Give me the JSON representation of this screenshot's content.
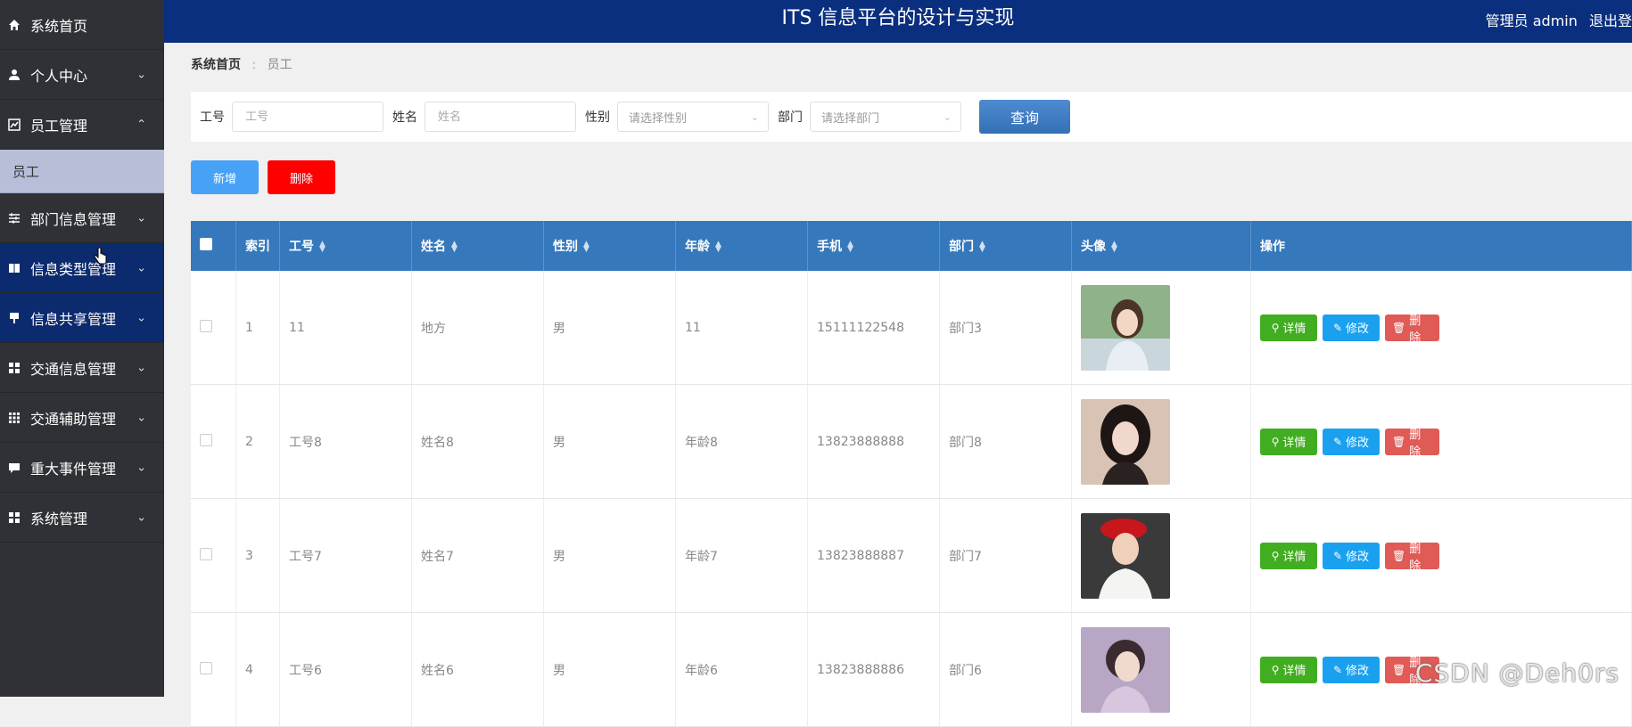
{
  "header": {
    "title": "ITS 信息平台的设计与实现",
    "user_label": "管理员 admin",
    "logout_label": "退出登"
  },
  "sidebar": {
    "items": [
      {
        "label": "系统首页",
        "icon": "home-icon"
      },
      {
        "label": "个人中心",
        "icon": "user-icon"
      },
      {
        "label": "员工管理",
        "icon": "chart-icon",
        "expanded": true,
        "sub": [
          "员工"
        ]
      },
      {
        "label": "部门信息管理",
        "icon": "sliders-icon"
      },
      {
        "label": "信息类型管理",
        "icon": "book-icon"
      },
      {
        "label": "信息共享管理",
        "icon": "pin-icon"
      },
      {
        "label": "交通信息管理",
        "icon": "grid-icon"
      },
      {
        "label": "交通辅助管理",
        "icon": "table-icon"
      },
      {
        "label": "重大事件管理",
        "icon": "comment-icon"
      },
      {
        "label": "系统管理",
        "icon": "grid-icon"
      }
    ]
  },
  "breadcrumb": {
    "home": "系统首页",
    "current": "员工"
  },
  "search": {
    "fields": [
      {
        "label": "工号",
        "placeholder": "工号",
        "type": "input"
      },
      {
        "label": "姓名",
        "placeholder": "姓名",
        "type": "input"
      },
      {
        "label": "性别",
        "placeholder": "请选择性别",
        "type": "select"
      },
      {
        "label": "部门",
        "placeholder": "请选择部门",
        "type": "select"
      }
    ],
    "query_label": "查询"
  },
  "toolbar": {
    "add_label": "新增",
    "delete_label": "删除"
  },
  "table": {
    "headers": [
      "索引",
      "工号",
      "姓名",
      "性别",
      "年龄",
      "手机",
      "部门",
      "头像",
      "操作"
    ],
    "rows": [
      {
        "index": "1",
        "job_no": "11",
        "name": "地方",
        "gender": "男",
        "age": "11",
        "phone": "15111122548",
        "dept": "部门3"
      },
      {
        "index": "2",
        "job_no": "工号8",
        "name": "姓名8",
        "gender": "男",
        "age": "年龄8",
        "phone": "13823888888",
        "dept": "部门8"
      },
      {
        "index": "3",
        "job_no": "工号7",
        "name": "姓名7",
        "gender": "男",
        "age": "年龄7",
        "phone": "13823888887",
        "dept": "部门7"
      },
      {
        "index": "4",
        "job_no": "工号6",
        "name": "姓名6",
        "gender": "男",
        "age": "年龄6",
        "phone": "13823888886",
        "dept": "部门6"
      }
    ],
    "actions": {
      "detail": "详情",
      "edit": "修改",
      "delete": "删除"
    }
  },
  "watermark": "CSDN @Deh0rs",
  "colors": {
    "header_bg": "#0a2f7f",
    "sidebar_bg": "#2f3136",
    "table_head_bg": "#3578bc",
    "add_btn": "#47a2f7",
    "delete_btn": "#ff0000",
    "detail_btn": "#41ad20",
    "edit_btn": "#19a1f0",
    "remove_btn": "#e05a56"
  }
}
